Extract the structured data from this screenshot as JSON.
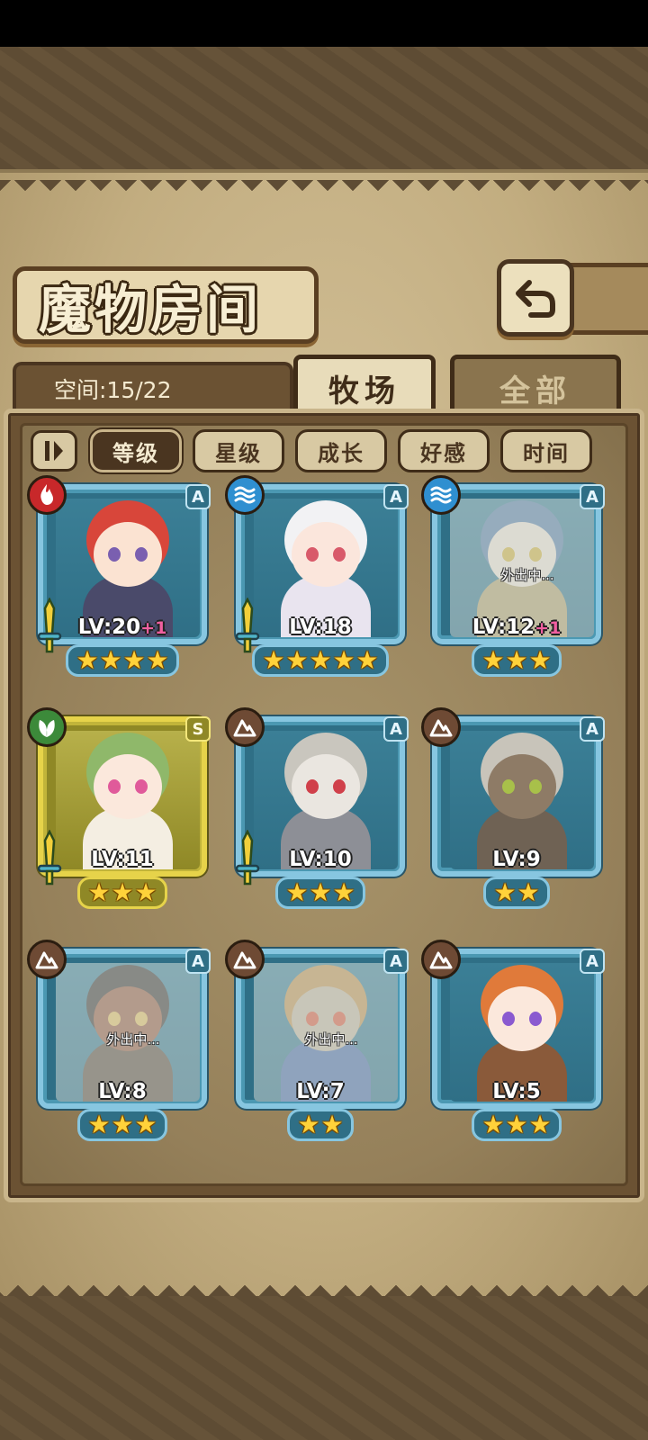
{
  "header": {
    "title": "魔物房间"
  },
  "capacity": {
    "label": "空间:15/22"
  },
  "tabs": [
    {
      "label": "牧场",
      "active": true
    },
    {
      "label": "全部",
      "active": false
    }
  ],
  "sort": {
    "toggle_icon": "sort-direction-icon",
    "options": [
      {
        "label": "等级",
        "active": true
      },
      {
        "label": "星级",
        "active": false
      },
      {
        "label": "成长",
        "active": false
      },
      {
        "label": "好感",
        "active": false
      },
      {
        "label": "时间",
        "active": false
      }
    ]
  },
  "monsters": [
    {
      "element": "fire",
      "rank": "A",
      "level": "LV:20",
      "bonus": "+1",
      "stars": 4,
      "weapon": true,
      "away": false,
      "frame": "blue",
      "hair": "#d8463a",
      "skin": "#fbe3d2",
      "outfit": "#4a4a6a",
      "eye": "#7a5fb0"
    },
    {
      "element": "water",
      "rank": "A",
      "level": "LV:18",
      "bonus": "",
      "stars": 5,
      "weapon": true,
      "away": false,
      "frame": "blue",
      "hair": "#f2f2f4",
      "skin": "#fbe6dc",
      "outfit": "#e9e4ef",
      "eye": "#d85a6a"
    },
    {
      "element": "water",
      "rank": "A",
      "level": "LV:12",
      "bonus": "+1",
      "stars": 3,
      "weapon": false,
      "away": true,
      "away_text": "外出中...",
      "frame": "blue",
      "hair": "#5a7fa8",
      "skin": "#f3e6d8",
      "outfit": "#b7a26a",
      "eye": "#d8b43a"
    },
    {
      "element": "wood",
      "rank": "S",
      "level": "LV:11",
      "bonus": "",
      "stars": 3,
      "weapon": true,
      "away": false,
      "frame": "gold",
      "hair": "#8fb86a",
      "skin": "#fbe8dc",
      "outfit": "#f4eee2",
      "eye": "#e05a9a"
    },
    {
      "element": "earth",
      "rank": "A",
      "level": "LV:10",
      "bonus": "",
      "stars": 3,
      "weapon": true,
      "away": false,
      "frame": "blue",
      "hair": "#c9c6be",
      "skin": "#eae6e0",
      "outfit": "#8d8f96",
      "eye": "#d0404a"
    },
    {
      "element": "earth",
      "rank": "A",
      "level": "LV:9",
      "bonus": "",
      "stars": 2,
      "weapon": false,
      "away": false,
      "frame": "blue",
      "hair": "#c8c4ba",
      "skin": "#8e7b66",
      "outfit": "#6f6254",
      "eye": "#a8c04a"
    },
    {
      "element": "earth",
      "rank": "A",
      "level": "LV:8",
      "bonus": "",
      "stars": 3,
      "weapon": false,
      "away": true,
      "away_text": "外出中...",
      "frame": "blue",
      "hair": "#3b3430",
      "skin": "#9a5a3c",
      "outfit": "#5c4a3a",
      "eye": "#e8c060"
    },
    {
      "element": "earth",
      "rank": "A",
      "level": "LV:7",
      "bonus": "",
      "stars": 2,
      "weapon": false,
      "away": true,
      "away_text": "外出中...",
      "frame": "blue",
      "hair": "#c6924c",
      "skin": "#c8b8a0",
      "outfit": "#4a6aa8",
      "eye": "#e05a3a"
    },
    {
      "element": "earth",
      "rank": "A",
      "level": "LV:5",
      "bonus": "",
      "stars": 3,
      "weapon": false,
      "away": false,
      "frame": "blue",
      "hair": "#e07a3a",
      "skin": "#fbe8dc",
      "outfit": "#8a5a3a",
      "eye": "#8a5ad0"
    }
  ],
  "colors": {
    "fire": "#c8282a",
    "water": "#2f8fd0",
    "wood": "#3c8a3a",
    "earth": "#6e4a34"
  }
}
